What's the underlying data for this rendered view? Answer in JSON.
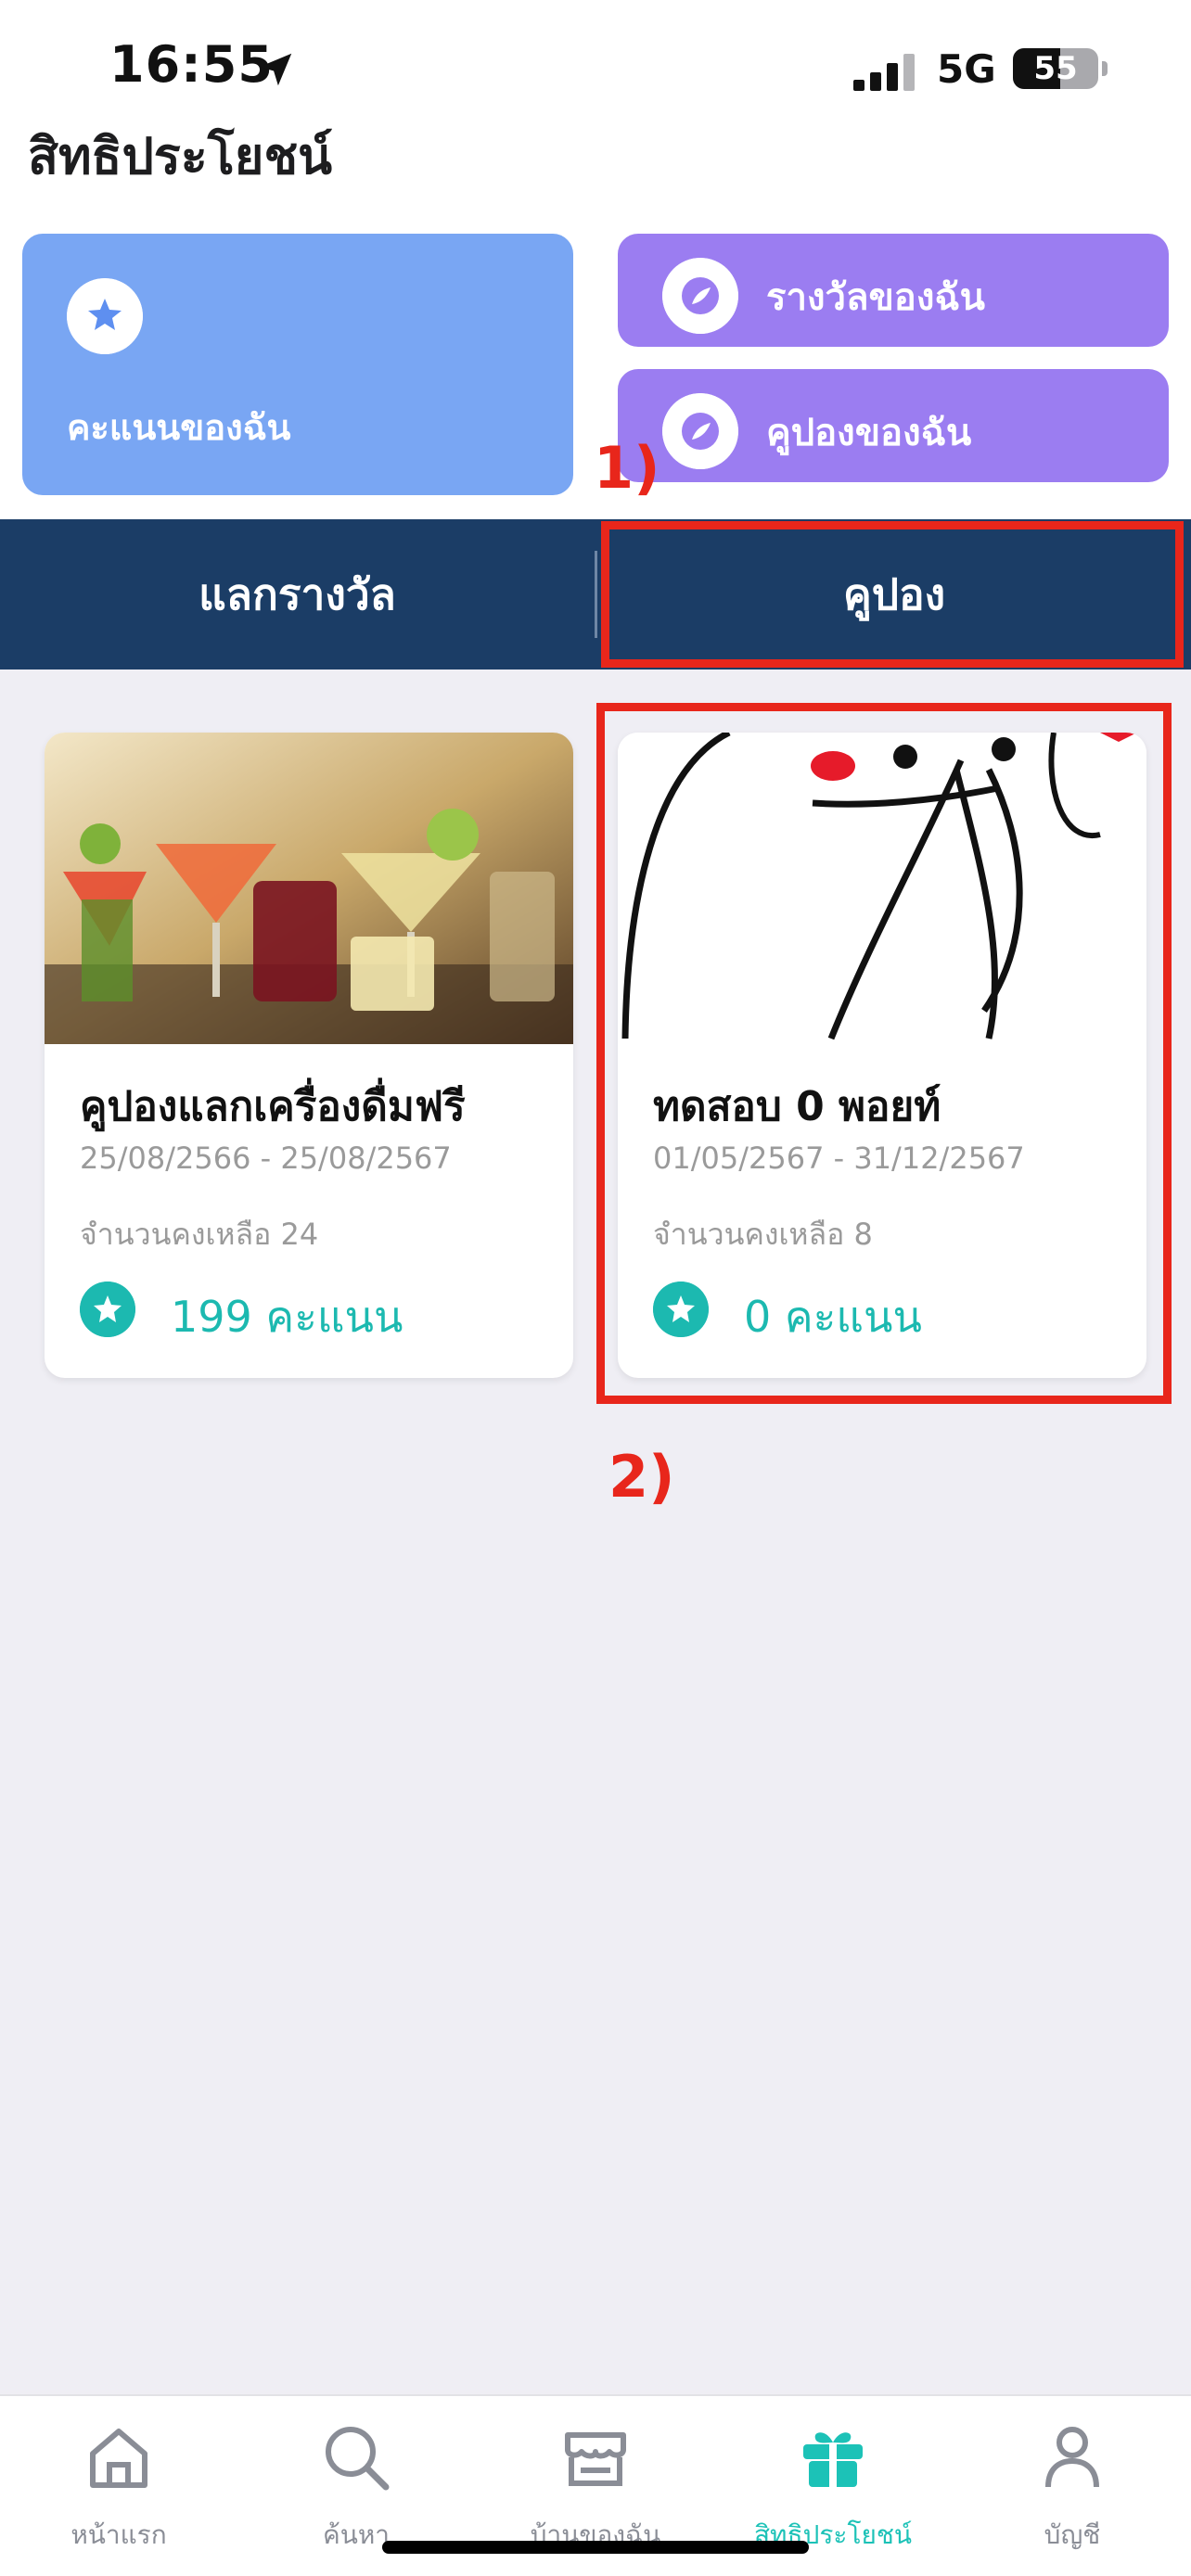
{
  "status_bar": {
    "time": "16:55",
    "network": "5G",
    "battery": "55",
    "battery_level": 0.55
  },
  "header": {
    "title": "สิทธิประโยชน์"
  },
  "summary": {
    "points_label": "คะแนนของฉัน",
    "my_rewards_label": "รางวัลของฉัน",
    "my_coupons_label": "คูปองของฉัน"
  },
  "annotations": {
    "step1": "1)",
    "step2": "2)"
  },
  "tabs": [
    {
      "label": "แลกรางวัล",
      "active": false
    },
    {
      "label": "คูปอง",
      "active": true
    }
  ],
  "coupons": [
    {
      "title": "คูปองแลกเครื่องดื่มฟรี",
      "dates": "25/08/2566 - 25/08/2567",
      "remaining": "จำนวนคงเหลือ 24",
      "points": "199 คะแนน",
      "image": "cocktails-photo"
    },
    {
      "title": "ทดสอบ 0 พอยท์",
      "dates": "01/05/2567 - 31/12/2567",
      "remaining": "จำนวนคงเหลือ 8",
      "points": "0 คะแนน",
      "image": "doodle-drawing"
    }
  ],
  "nav": [
    {
      "label": "หน้าแรก",
      "icon": "home-icon",
      "active": false
    },
    {
      "label": "ค้นหา",
      "icon": "search-icon",
      "active": false
    },
    {
      "label": "บ้านของฉัน",
      "icon": "store-icon",
      "active": false
    },
    {
      "label": "สิทธิประโยชน์",
      "icon": "gift-icon",
      "active": true
    },
    {
      "label": "บัญชี",
      "icon": "account-icon",
      "active": false
    }
  ],
  "colors": {
    "accent": "#1cc2b7",
    "tab_bg": "#1b3d66",
    "points_card": "#79a6f3",
    "reward_card": "#9b7df1",
    "annotation": "#e8261b"
  }
}
